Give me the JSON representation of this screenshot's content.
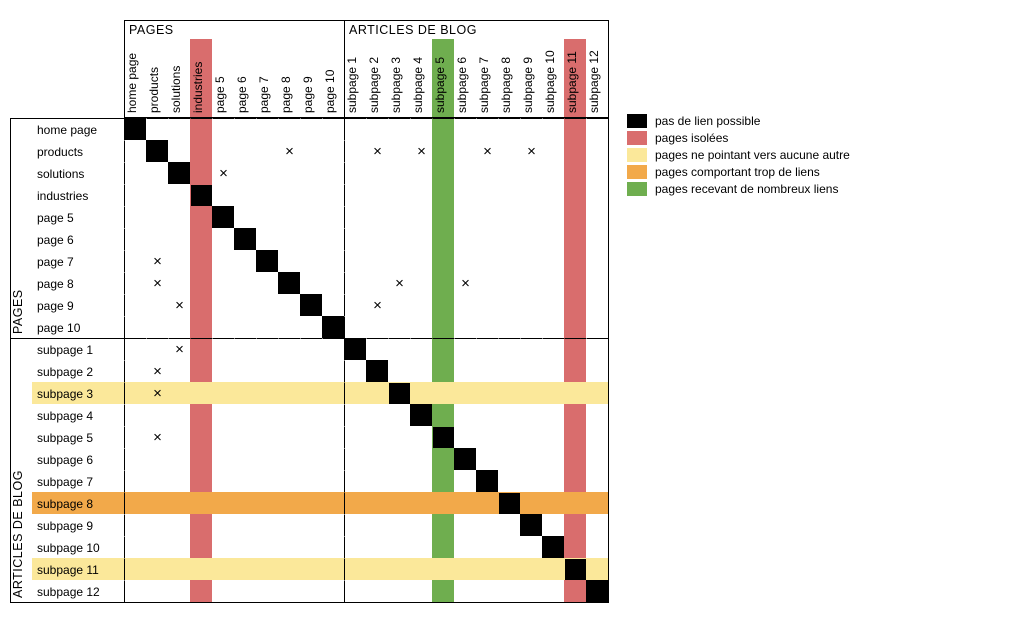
{
  "groups": {
    "pages": "PAGES",
    "blog": "ARTICLES DE BLOG"
  },
  "labels": [
    "home page",
    "products",
    "solutions",
    "industries",
    "page 5",
    "page 6",
    "page 7",
    "page 8",
    "page 9",
    "page 10",
    "subpage 1",
    "subpage 2",
    "subpage 3",
    "subpage 4",
    "subpage 5",
    "subpage 6",
    "subpage 7",
    "subpage 8",
    "subpage 9",
    "subpage 10",
    "subpage 11",
    "subpage 12"
  ],
  "legend": {
    "black": "pas de lien possible",
    "red": "pages isolées",
    "yellow": "pages ne pointant vers aucune autre",
    "orange": "pages comportant trop de liens",
    "green": "pages recevant de nombreux liens"
  },
  "chart_data": {
    "type": "heatmap",
    "title": "",
    "n": 22,
    "group_split_index": 10,
    "row_labels": [
      "home page",
      "products",
      "solutions",
      "industries",
      "page 5",
      "page 6",
      "page 7",
      "page 8",
      "page 9",
      "page 10",
      "subpage 1",
      "subpage 2",
      "subpage 3",
      "subpage 4",
      "subpage 5",
      "subpage 6",
      "subpage 7",
      "subpage 8",
      "subpage 9",
      "subpage 10",
      "subpage 11",
      "subpage 12"
    ],
    "col_labels": [
      "home page",
      "products",
      "solutions",
      "industries",
      "page 5",
      "page 6",
      "page 7",
      "page 8",
      "page 9",
      "page 10",
      "subpage 1",
      "subpage 2",
      "subpage 3",
      "subpage 4",
      "subpage 5",
      "subpage 6",
      "subpage 7",
      "subpage 8",
      "subpage 9",
      "subpage 10",
      "subpage 11",
      "subpage 12"
    ],
    "diagonal": "no-self-link",
    "links": [
      [
        1,
        7
      ],
      [
        1,
        11
      ],
      [
        1,
        13
      ],
      [
        1,
        16
      ],
      [
        1,
        18
      ],
      [
        2,
        4
      ],
      [
        6,
        1
      ],
      [
        7,
        1
      ],
      [
        7,
        12
      ],
      [
        7,
        15
      ],
      [
        8,
        2
      ],
      [
        8,
        11
      ],
      [
        10,
        2
      ],
      [
        11,
        1
      ],
      [
        12,
        1
      ],
      [
        14,
        1
      ]
    ],
    "col_highlights": {
      "3": "red",
      "14": "green",
      "20": "red"
    },
    "row_highlights": {
      "12": "yellow",
      "17": "orange",
      "20": "yellow"
    }
  }
}
